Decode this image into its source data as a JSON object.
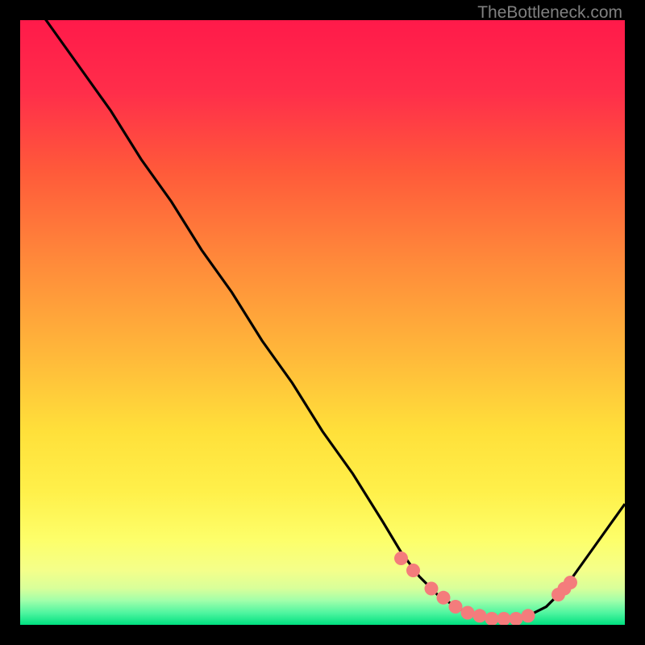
{
  "watermark": "TheBottleneck.com",
  "chart_data": {
    "type": "line",
    "title": "",
    "xlabel": "",
    "ylabel": "",
    "xlim": [
      0,
      100
    ],
    "ylim": [
      0,
      100
    ],
    "series": [
      {
        "name": "bottleneck-curve",
        "x": [
          0,
          5,
          10,
          15,
          20,
          25,
          30,
          35,
          40,
          45,
          50,
          55,
          60,
          63,
          66,
          69,
          72,
          75,
          78,
          81,
          84,
          87,
          90,
          95,
          100
        ],
        "y": [
          106,
          99,
          92,
          85,
          77,
          70,
          62,
          55,
          47,
          40,
          32,
          25,
          17,
          12,
          8,
          5,
          3,
          1.5,
          1,
          1,
          1.5,
          3,
          6,
          13,
          20
        ]
      }
    ],
    "markers": {
      "name": "highlight-points",
      "x": [
        63,
        65,
        68,
        70,
        72,
        74,
        76,
        78,
        80,
        82,
        84,
        89,
        90,
        91
      ],
      "y": [
        11,
        9,
        6,
        4.5,
        3,
        2,
        1.5,
        1,
        1,
        1,
        1.5,
        5,
        6,
        7
      ]
    },
    "gradient_colors": {
      "top": "#ff1744",
      "upper_mid": "#ff5e3a",
      "mid": "#ffd740",
      "lower_mid": "#fff59d",
      "bottom": "#00e676"
    }
  }
}
